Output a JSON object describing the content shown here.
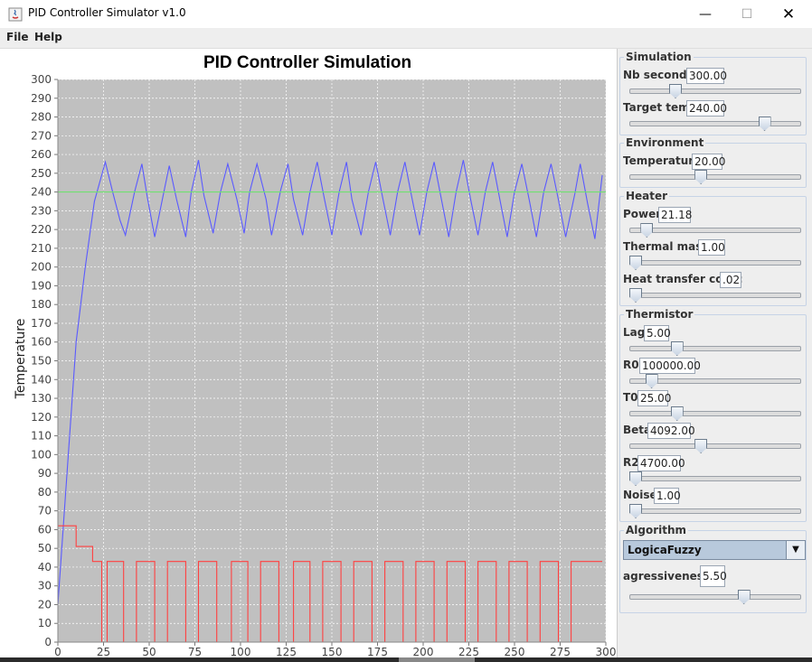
{
  "window": {
    "title": "PID Controller Simulator v1.0",
    "minimize": "—",
    "maximize": "☐",
    "close": "✕"
  },
  "menu": {
    "file": "File",
    "help": "Help"
  },
  "chart_data": {
    "type": "line",
    "title": "PID Controller Simulation",
    "ylabel": "Temperature",
    "xlabel": "",
    "xlim": [
      0,
      300
    ],
    "ylim": [
      0,
      300
    ],
    "xticks": [
      0,
      25,
      50,
      75,
      100,
      125,
      150,
      175,
      200,
      225,
      250,
      275,
      300
    ],
    "yticks": [
      0,
      10,
      20,
      30,
      40,
      50,
      60,
      70,
      80,
      90,
      100,
      110,
      120,
      130,
      140,
      150,
      160,
      170,
      180,
      190,
      200,
      210,
      220,
      230,
      240,
      250,
      260,
      270,
      280,
      290,
      300
    ],
    "grid": true,
    "background": "#c0c0c0",
    "series": [
      {
        "color": "#5a5aff",
        "x": [
          0,
          5,
          10,
          15,
          20,
          26,
          30,
          34,
          37,
          42,
          46,
          49,
          53,
          58,
          61,
          65,
          70,
          73,
          77,
          80,
          85,
          89,
          93,
          98,
          102,
          105,
          109,
          114,
          117,
          122,
          126,
          129,
          134,
          138,
          142,
          146,
          150,
          154,
          158,
          161,
          166,
          170,
          174,
          178,
          182,
          186,
          190,
          194,
          198,
          202,
          206,
          210,
          214,
          218,
          222,
          226,
          230,
          234,
          238,
          242,
          246,
          250,
          254,
          258,
          262,
          266,
          270,
          274,
          278,
          283,
          286,
          290,
          294,
          298
        ],
        "y": [
          20,
          90,
          160,
          200,
          235,
          256,
          240,
          225,
          217,
          240,
          255,
          237,
          216,
          240,
          254,
          236,
          216,
          240,
          257,
          238,
          218,
          240,
          255,
          236,
          218,
          240,
          255,
          236,
          217,
          241,
          255,
          236,
          217,
          240,
          256,
          236,
          217,
          240,
          256,
          236,
          217,
          240,
          256,
          236,
          217,
          240,
          256,
          236,
          217,
          240,
          256,
          236,
          216,
          240,
          257,
          236,
          217,
          240,
          256,
          236,
          216,
          240,
          255,
          236,
          216,
          240,
          255,
          236,
          216,
          239,
          255,
          234,
          215,
          249
        ]
      },
      {
        "color": "#70e070",
        "x": [
          0,
          300
        ],
        "y": [
          240,
          240
        ]
      },
      {
        "color": "#ff4040",
        "x": [
          0,
          10,
          10,
          19,
          19,
          24,
          24,
          27,
          27,
          36,
          36,
          43,
          43,
          53,
          53,
          60,
          60,
          70,
          70,
          77,
          77,
          87,
          87,
          95,
          95,
          104,
          104,
          111,
          111,
          121,
          121,
          129,
          129,
          138,
          138,
          145,
          145,
          155,
          155,
          162,
          162,
          172,
          172,
          179,
          179,
          189,
          189,
          196,
          196,
          206,
          206,
          213,
          213,
          223,
          223,
          230,
          230,
          240,
          240,
          247,
          247,
          257,
          257,
          264,
          264,
          274,
          274,
          281,
          281,
          291,
          291,
          298
        ],
        "y": [
          62,
          62,
          51,
          51,
          43,
          43,
          0,
          0,
          43,
          43,
          0,
          0,
          43,
          43,
          0,
          0,
          43,
          43,
          0,
          0,
          43,
          43,
          0,
          0,
          43,
          43,
          0,
          0,
          43,
          43,
          0,
          0,
          43,
          43,
          0,
          0,
          43,
          43,
          0,
          0,
          43,
          43,
          0,
          0,
          43,
          43,
          0,
          0,
          43,
          43,
          0,
          0,
          43,
          43,
          0,
          0,
          43,
          43,
          0,
          0,
          43,
          43,
          0,
          0,
          43,
          43,
          0,
          0,
          43,
          43,
          43,
          43
        ]
      }
    ]
  },
  "panel": {
    "simulation": {
      "title": "Simulation",
      "nb_seconds_label": "Nb seconds:",
      "nb_seconds_value": "300.00",
      "nb_seconds_level": 0.25,
      "target_temp_label": "Target temp:",
      "target_temp_value": "240.00",
      "target_temp_level": 0.81
    },
    "environment": {
      "title": "Environment",
      "temperature_label": "Temperature:",
      "temperature_value": "20.00",
      "temperature_level": 0.41
    },
    "heater": {
      "title": "Heater",
      "power_label": "Power:",
      "power_value": "21.18",
      "power_level": 0.07,
      "thermal_mass_label": "Thermal mass:",
      "thermal_mass_value": "1.00",
      "thermal_mass_level": 0.0,
      "heat_transfer_label": "Heat transfer coef.:",
      "heat_transfer_value": ".02",
      "heat_transfer_level": 0.0
    },
    "thermistor": {
      "title": "Thermistor",
      "lag_label": "Lag:",
      "lag_value": "5.00",
      "lag_level": 0.26,
      "r0_label": "R0:",
      "r0_value": "100000.00",
      "r0_level": 0.1,
      "t0_label": "T0:",
      "t0_value": "25.00",
      "t0_level": 0.26,
      "beta_label": "Beta:",
      "beta_value": "4092.00",
      "beta_level": 0.41,
      "r2_label": "R2:",
      "r2_value": "4700.00",
      "r2_level": 0.0,
      "noise_label": "Noise:",
      "noise_value": "1.00",
      "noise_level": 0.0
    },
    "algorithm": {
      "title": "Algorithm",
      "selected": "LogicaFuzzy",
      "aggressiveness_label": "agressiveness:",
      "aggressiveness_value": "5.50",
      "aggressiveness_level": 0.68
    }
  }
}
